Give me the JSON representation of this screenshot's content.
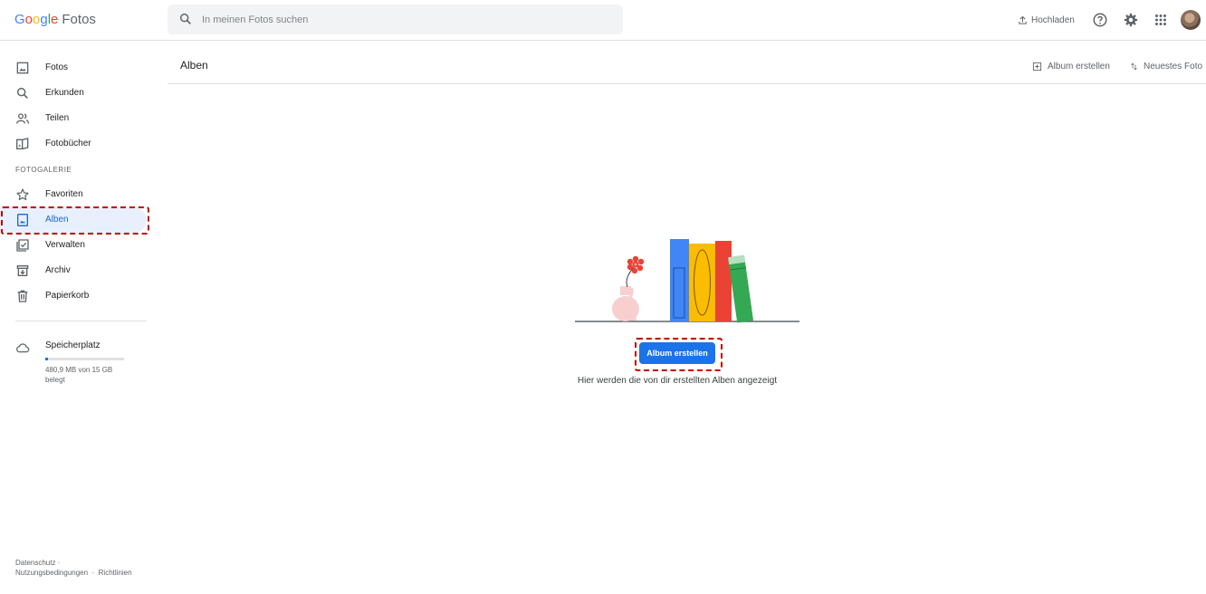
{
  "header": {
    "logo_letters": [
      "G",
      "o",
      "o",
      "g",
      "l",
      "e"
    ],
    "product": "Fotos",
    "search_placeholder": "In meinen Fotos suchen",
    "upload_label": "Hochladen",
    "icons": [
      "search-icon",
      "upload-icon",
      "help-icon",
      "settings-icon",
      "apps-icon"
    ]
  },
  "sidebar": {
    "items": [
      {
        "label": "Fotos",
        "icon": "photo-icon"
      },
      {
        "label": "Erkunden",
        "icon": "search-icon"
      },
      {
        "label": "Teilen",
        "icon": "people-icon"
      },
      {
        "label": "Fotobücher",
        "icon": "photobook-icon"
      }
    ],
    "section_label": "FOTOGALERIE",
    "library": [
      {
        "label": "Favoriten",
        "icon": "star-icon"
      },
      {
        "label": "Alben",
        "icon": "album-icon",
        "active": true
      },
      {
        "label": "Verwalten",
        "icon": "manage-icon"
      },
      {
        "label": "Archiv",
        "icon": "archive-icon"
      },
      {
        "label": "Papierkorb",
        "icon": "trash-icon"
      }
    ],
    "storage": {
      "title": "Speicherplatz",
      "usage_text": "480,9 MB von 15 GB belegt",
      "used_fraction": 0.03
    },
    "footer": {
      "privacy": "Datenschutz",
      "terms": "Nutzungsbedingungen",
      "policies": "Richtlinien",
      "separator": "·"
    }
  },
  "main": {
    "title": "Alben",
    "create_album_label": "Album erstellen",
    "sort_label": "Neuestes Foto",
    "empty_button": "Album erstellen",
    "empty_text": "Hier werden die von dir erstellten Alben angezeigt"
  },
  "colors": {
    "accent": "#1a73e8",
    "active_bg": "#e8f0fe",
    "highlight_dash": "#c00000",
    "book_blue": "#4285f4",
    "book_yellow": "#fbbc04",
    "book_red": "#ea4335",
    "book_green": "#34a853",
    "vase": "#f8cfcf"
  }
}
